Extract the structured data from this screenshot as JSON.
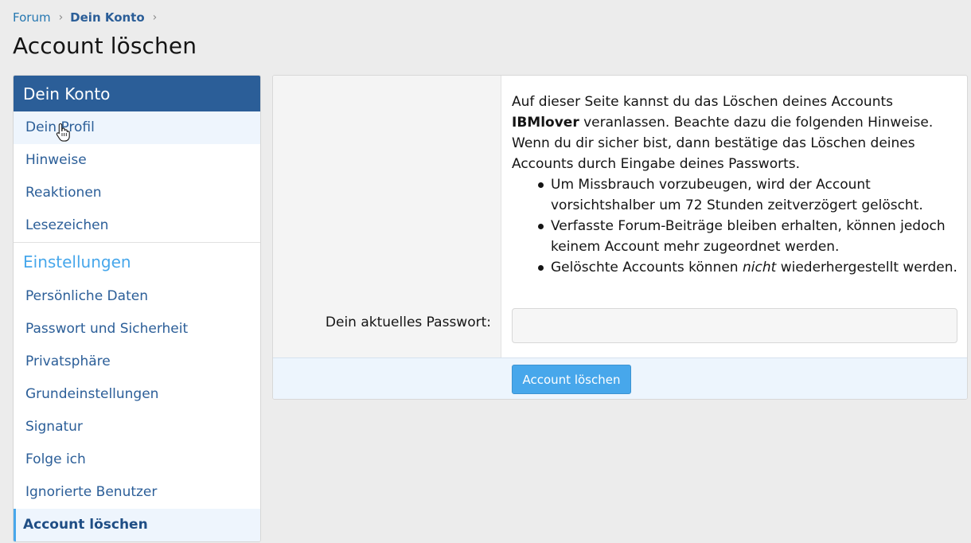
{
  "breadcrumb": {
    "items": [
      {
        "label": "Forum"
      },
      {
        "label": "Dein Konto"
      }
    ],
    "separator": "›"
  },
  "page": {
    "title": "Account löschen"
  },
  "sidebar": {
    "header": "Dein Konto",
    "account_items": [
      {
        "label": "Dein Profil",
        "state": "hover"
      },
      {
        "label": "Hinweise"
      },
      {
        "label": "Reaktionen"
      },
      {
        "label": "Lesezeichen"
      }
    ],
    "settings_title": "Einstellungen",
    "settings_items": [
      {
        "label": "Persönliche Daten"
      },
      {
        "label": "Passwort und Sicherheit"
      },
      {
        "label": "Privatsphäre"
      },
      {
        "label": "Grundeinstellungen"
      },
      {
        "label": "Signatur"
      },
      {
        "label": "Folge ich"
      },
      {
        "label": "Ignorierte Benutzer"
      },
      {
        "label": "Account löschen",
        "state": "active"
      }
    ]
  },
  "main": {
    "intro_before": "Auf dieser Seite kannst du das Löschen deines Accounts ",
    "username": "IBMlover",
    "intro_after": " veranlassen. Beachte dazu die folgenden Hinweise. Wenn du dir sicher bist, dann bestätige das Löschen deines Accounts durch Eingabe deines Passworts.",
    "notes": [
      "Um Missbrauch vorzubeugen, wird der Account vorsichtshalber um 72 Stunden zeitverzögert gelöscht.",
      "Verfasste Forum-Beiträge bleiben erhalten, können jedoch keinem Account mehr zugeordnet werden."
    ],
    "note_last_before": "Gelöschte Accounts können ",
    "note_last_emph": "nicht",
    "note_last_after": " wiederhergestellt werden.",
    "password_label": "Dein aktuelles Passwort:",
    "password_value": "",
    "submit_label": "Account löschen"
  },
  "colors": {
    "header_bg": "#2b5e98",
    "accent": "#47a7eb",
    "link": "#2b5e98",
    "page_bg": "#ececec"
  },
  "icons": {
    "breadcrumb_separator": "chevron-right-icon",
    "cursor": "hand-pointer-icon"
  }
}
